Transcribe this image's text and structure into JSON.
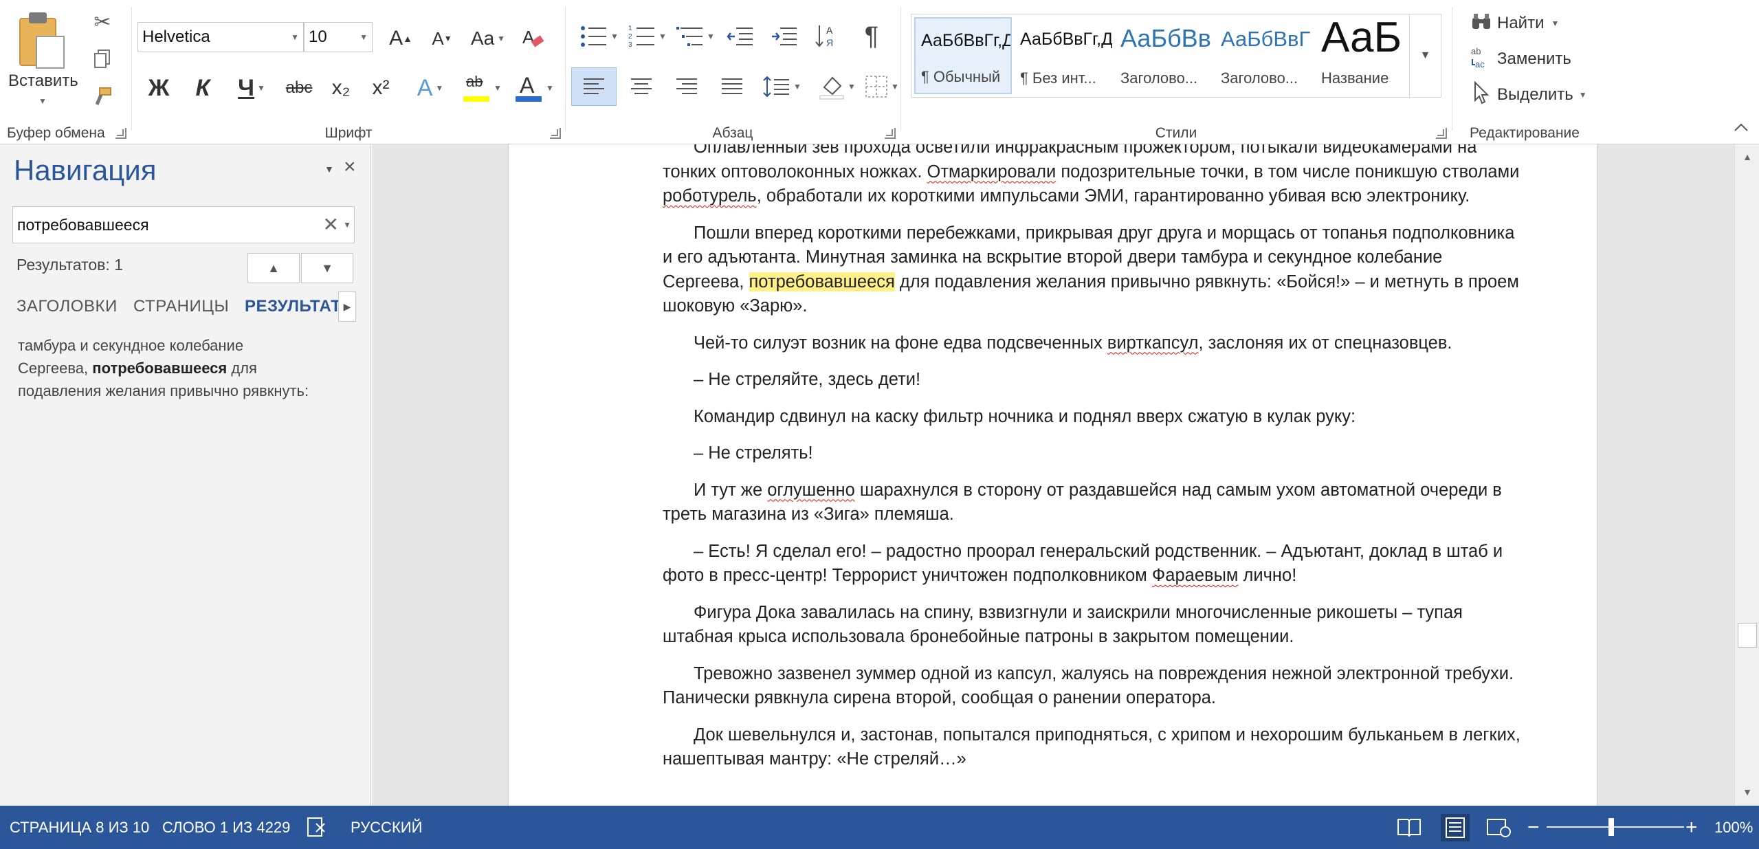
{
  "ribbon": {
    "clipboard": {
      "paste_label": "Вставить",
      "group_label": "Буфер обмена"
    },
    "font": {
      "name": "Helvetica",
      "size": "10",
      "group_label": "Шрифт",
      "bold": "Ж",
      "italic": "К",
      "underline": "Ч",
      "strike": "abc",
      "subscript": "x₂",
      "superscript": "x²",
      "grow": "A",
      "shrink": "A",
      "case": "Aa"
    },
    "paragraph": {
      "group_label": "Абзац",
      "pilcrow": "¶"
    },
    "styles": {
      "group_label": "Стили",
      "items": [
        {
          "preview": "АаБбВвГг,Д",
          "name": "¶ Обычный"
        },
        {
          "preview": "АаБбВвГг,Д",
          "name": "¶ Без инт..."
        },
        {
          "preview": "АаБбВв",
          "name": "Заголово..."
        },
        {
          "preview": "АаБбВвГ",
          "name": "Заголово..."
        },
        {
          "preview": "АаБ",
          "name": "Название"
        }
      ]
    },
    "editing": {
      "group_label": "Редактирование",
      "find": "Найти",
      "replace": "Заменить",
      "select": "Выделить"
    }
  },
  "nav": {
    "title": "Навигация",
    "search_value": "потребовавшееся",
    "count": "Результатов: 1",
    "tabs": [
      "ЗАГОЛОВКИ",
      "СТРАНИЦЫ",
      "РЕЗУЛЬТАТЫ"
    ],
    "result_before": "тамбура и секундное колебание Сергеева, ",
    "result_match": "потребовавшееся",
    "result_after": " для подавления желания привычно рявкнуть:"
  },
  "document": {
    "p0_a": "Оплавленный зев прохода осветили инфракрасным прожектором, потыкали видеокамерами на тонких оптоволоконных ножках. ",
    "p0_s1": "Отмаркировали",
    "p0_b": " подозрительные точки, в том числе поникшую стволами ",
    "p0_s2": "роботурель",
    "p0_c": ", обработали их короткими импульсами ЭМИ, гарантированно убивая всю электронику.",
    "p1_a": "Пошли вперед короткими перебежками, прикрывая друг друга и морщась от топанья подполковника и его адъютанта. Минутная заминка на вскрытие второй двери тамбура и секундное колебание Сергеева, ",
    "p1_hl": "потребовавшееся",
    "p1_b": " для подавления желания привычно рявкнуть: «Бойся!» – и метнуть в проем шоковую «Зарю».",
    "p2_a": "Чей-то силуэт возник на фоне едва подсвеченных ",
    "p2_s": "вирткапсул",
    "p2_b": ", заслоняя их от спецназовцев.",
    "p3": "–  Не стреляйте, здесь дети!",
    "p4": "Командир сдвинул на каску фильтр ночника и поднял вверх сжатую в кулак руку:",
    "p5": "–  Не стрелять!",
    "p6_a": "И тут же ",
    "p6_s": "оглушенно",
    "p6_b": " шарахнулся в сторону от раздавшейся над самым ухом автоматной очереди в треть магазина из «Зига» племяша.",
    "p7_a": "–  Есть! Я сделал его! – радостно проорал генеральский родственник. – Адъютант, доклад в штаб и фото в пресс-центр! Террорист уничтожен подполковником ",
    "p7_s": "Фараевым",
    "p7_b": " лично!",
    "p8": "Фигура Дока завалилась на спину, взвизгнули и заискрили многочисленные рикошеты – тупая штабная крыса использовала бронебойные патроны в закрытом помещении.",
    "p9": "Тревожно зазвенел зуммер одной из капсул, жалуясь на повреждения нежной электронной требухи. Панически рявкнула сирена второй, сообщая о ранении оператора.",
    "p10": "Док шевельнулся и, застонав, попытался приподняться, с хрипом и нехорошим бульканьем в легких, нашептывая мантру: «Не стреляй…»"
  },
  "status": {
    "page": "СТРАНИЦА 8 ИЗ 10",
    "words": "СЛОВО 1 ИЗ 4229",
    "language": "РУССКИЙ",
    "zoom": "100%",
    "zoom_minus": "−",
    "zoom_plus": "+"
  }
}
